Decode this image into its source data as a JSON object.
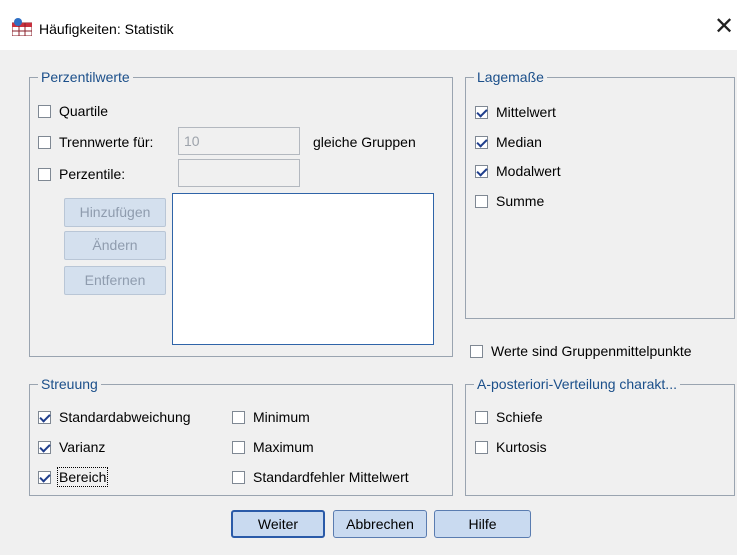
{
  "window": {
    "title": "Häufigkeiten: Statistik",
    "close_glyph": "✕"
  },
  "perzentilwerte": {
    "legend": "Perzentilwerte",
    "quartile": {
      "label": "Quartile",
      "checked": false
    },
    "trennwerte": {
      "label": "Trennwerte für:",
      "value": "10",
      "suffix": "gleiche Gruppen",
      "checked": false
    },
    "perzentile": {
      "label": "Perzentile:",
      "value": "",
      "checked": false
    },
    "buttons": {
      "add": "Hinzufügen",
      "change": "Ändern",
      "remove": "Entfernen"
    }
  },
  "lagemasse": {
    "legend": "Lagemaße",
    "items": [
      {
        "label": "Mittelwert",
        "checked": true
      },
      {
        "label": "Median",
        "checked": true
      },
      {
        "label": "Modalwert",
        "checked": true
      },
      {
        "label": "Summe",
        "checked": false
      }
    ]
  },
  "gruppenmittelpunkte": {
    "label": "Werte sind Gruppenmittelpunkte",
    "checked": false
  },
  "streuung": {
    "legend": "Streuung",
    "items": [
      {
        "label": "Standardabweichung",
        "checked": true
      },
      {
        "label": "Minimum",
        "checked": false
      },
      {
        "label": "Varianz",
        "checked": true
      },
      {
        "label": "Maximum",
        "checked": false
      },
      {
        "label": "Bereich",
        "checked": true
      },
      {
        "label": "Standardfehler Mittelwert",
        "checked": false
      }
    ]
  },
  "verteilung": {
    "legend": "A-posteriori-Verteilung charakt...",
    "items": [
      {
        "label": "Schiefe",
        "checked": false
      },
      {
        "label": "Kurtosis",
        "checked": false
      }
    ]
  },
  "footer": {
    "weiter": "Weiter",
    "abbrechen": "Abbrechen",
    "hilfe": "Hilfe"
  },
  "colors": {
    "legend_text": "#1b4f8a",
    "check_mark": "#1f3e8c",
    "button_face": "#c9daf0",
    "dialog_bg": "#f0f0f0"
  }
}
